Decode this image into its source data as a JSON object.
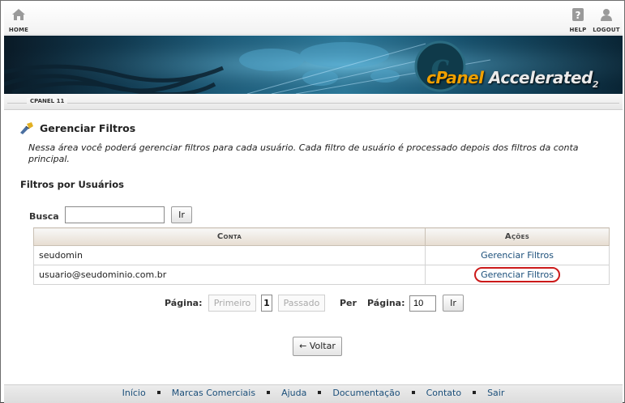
{
  "topbar": {
    "home_label": "HOME",
    "help_label": "HELP",
    "logout_label": "LOGOUT"
  },
  "banner": {
    "brand_text": "cPanel",
    "brand_suffix": "Accelerated",
    "brand_version": "2"
  },
  "version_label": "CPANEL 11",
  "page": {
    "title": "Gerenciar Filtros",
    "description": "Nessa área você poderá gerenciar filtros para cada usuário. Cada filtro de usuário é processado depois dos filtros da conta principal.",
    "section_title": "Filtros por Usuários"
  },
  "search": {
    "label": "Busca",
    "value": "",
    "button": "Ir"
  },
  "table": {
    "headers": [
      "Conta",
      "Ações"
    ],
    "rows": [
      {
        "account": "seudomin",
        "action": "Gerenciar Filtros"
      },
      {
        "account": "usuario@seudominio.com.br",
        "action": "Gerenciar Filtros"
      }
    ]
  },
  "pager": {
    "page_label": "Página:",
    "first": "Primeiro",
    "current": "1",
    "prev": "Passado",
    "per_label": "Per",
    "per_page_label": "Página:",
    "per_page_value": "10",
    "go": "Ir"
  },
  "back_button": "← Voltar",
  "footer": {
    "links": [
      "Início",
      "Marcas Comerciais",
      "Ajuda",
      "Documentação",
      "Contato",
      "Sair"
    ]
  },
  "colors": {
    "link": "#1b4f7a",
    "highlight": "#cc1a1a",
    "banner": "#1d5f7e"
  }
}
